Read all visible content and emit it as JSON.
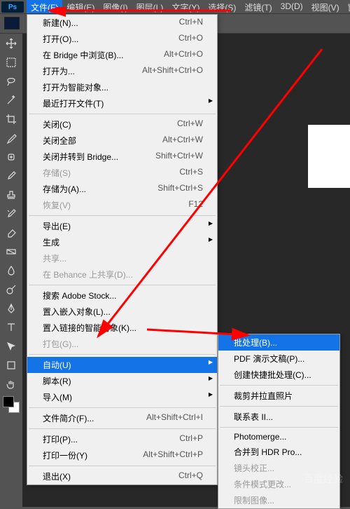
{
  "app_badge": "Ps",
  "menubar": {
    "items": [
      "文件(F)",
      "编辑(E)",
      "图像(I)",
      "图层(L)",
      "文字(Y)",
      "选择(S)",
      "滤镜(T)",
      "3D(D)",
      "视图(V)",
      "窗口(W)"
    ],
    "active_index": 0
  },
  "file_menu": [
    {
      "label": "新建(N)...",
      "shortcut": "Ctrl+N"
    },
    {
      "label": "打开(O)...",
      "shortcut": "Ctrl+O"
    },
    {
      "label": "在 Bridge 中浏览(B)...",
      "shortcut": "Alt+Ctrl+O"
    },
    {
      "label": "打开为...",
      "shortcut": "Alt+Shift+Ctrl+O"
    },
    {
      "label": "打开为智能对象..."
    },
    {
      "label": "最近打开文件(T)",
      "arrow": true
    },
    {
      "sep": true
    },
    {
      "label": "关闭(C)",
      "shortcut": "Ctrl+W"
    },
    {
      "label": "关闭全部",
      "shortcut": "Alt+Ctrl+W"
    },
    {
      "label": "关闭并转到 Bridge...",
      "shortcut": "Shift+Ctrl+W"
    },
    {
      "label": "存储(S)",
      "shortcut": "Ctrl+S",
      "disabled": true
    },
    {
      "label": "存储为(A)...",
      "shortcut": "Shift+Ctrl+S"
    },
    {
      "label": "恢复(V)",
      "shortcut": "F12",
      "disabled": true
    },
    {
      "sep": true
    },
    {
      "label": "导出(E)",
      "arrow": true
    },
    {
      "label": "生成",
      "arrow": true
    },
    {
      "label": "共享...",
      "disabled": true
    },
    {
      "label": "在 Behance 上共享(D)...",
      "disabled": true
    },
    {
      "sep": true
    },
    {
      "label": "搜索 Adobe Stock..."
    },
    {
      "label": "置入嵌入对象(L)..."
    },
    {
      "label": "置入链接的智能对象(K)..."
    },
    {
      "label": "打包(G)...",
      "disabled": true
    },
    {
      "sep": true
    },
    {
      "label": "自动(U)",
      "arrow": true,
      "highlighted": true
    },
    {
      "label": "脚本(R)",
      "arrow": true
    },
    {
      "label": "导入(M)",
      "arrow": true
    },
    {
      "sep": true
    },
    {
      "label": "文件简介(F)...",
      "shortcut": "Alt+Shift+Ctrl+I"
    },
    {
      "sep": true
    },
    {
      "label": "打印(P)...",
      "shortcut": "Ctrl+P"
    },
    {
      "label": "打印一份(Y)",
      "shortcut": "Alt+Shift+Ctrl+P"
    },
    {
      "sep": true
    },
    {
      "label": "退出(X)",
      "shortcut": "Ctrl+Q"
    }
  ],
  "auto_submenu": [
    {
      "label": "批处理(B)...",
      "highlighted": true
    },
    {
      "label": "PDF 演示文稿(P)..."
    },
    {
      "label": "创建快捷批处理(C)..."
    },
    {
      "sep": true
    },
    {
      "label": "裁剪并拉直照片"
    },
    {
      "sep": true
    },
    {
      "label": "联系表 II..."
    },
    {
      "sep": true
    },
    {
      "label": "Photomerge..."
    },
    {
      "label": "合并到 HDR Pro..."
    },
    {
      "label": "镜头校正...",
      "disabled": true
    },
    {
      "label": "条件模式更改...",
      "disabled": true
    },
    {
      "label": "限制图像...",
      "disabled": true
    }
  ],
  "watermark": "百度经验"
}
